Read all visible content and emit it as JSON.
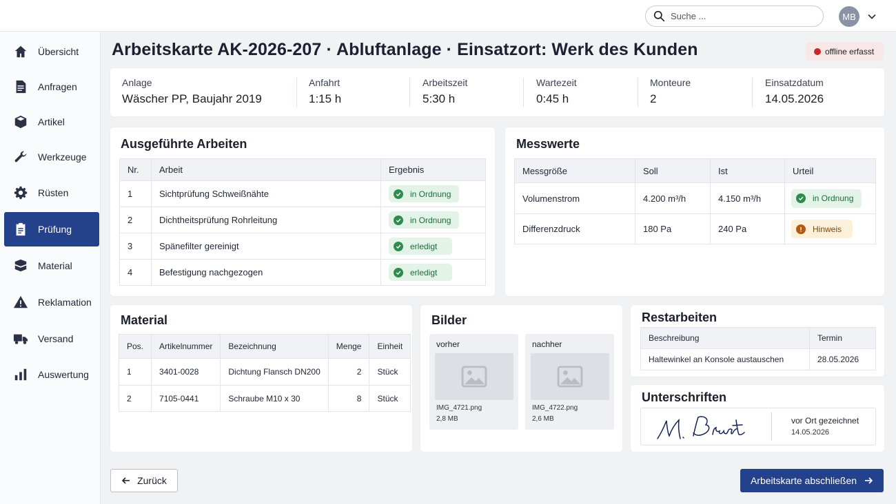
{
  "header": {
    "search_placeholder": "Suche ...",
    "avatar_initials": "MB"
  },
  "sidebar": {
    "items": [
      {
        "label": "Übersicht",
        "icon": "home-icon"
      },
      {
        "label": "Anfragen",
        "icon": "document-icon"
      },
      {
        "label": "Artikel",
        "icon": "box-icon"
      },
      {
        "label": "Werkzeuge",
        "icon": "wrench-icon"
      },
      {
        "label": "Rüsten",
        "icon": "gear-icon"
      },
      {
        "label": "Prüfung",
        "icon": "clipboard-icon",
        "active": true
      },
      {
        "label": "Material",
        "icon": "boxes-icon"
      },
      {
        "label": "Reklamation",
        "icon": "warning-icon"
      },
      {
        "label": "Versand",
        "icon": "truck-icon"
      },
      {
        "label": "Auswertung",
        "icon": "bar-chart-icon"
      }
    ]
  },
  "page": {
    "title": "Arbeitskarte AK-2026-207 · Abluftanlage · Einsatzort: Werk des Kunden",
    "status_badge": "offline erfasst",
    "status_color": "#c82727"
  },
  "info": [
    {
      "key": "Anlage",
      "value": "Wäscher PP, Baujahr 2019"
    },
    {
      "key": "Anfahrt",
      "value": "1:15 h"
    },
    {
      "key": "Arbeitszeit",
      "value": "5:30 h"
    },
    {
      "key": "Wartezeit",
      "value": "0:45 h"
    },
    {
      "key": "Monteure",
      "value": "2"
    },
    {
      "key": "Einsatzdatum",
      "value": "14.05.2026"
    }
  ],
  "arbeiten": {
    "title": "Ausgeführte Arbeiten",
    "headers": [
      "Nr.",
      "Arbeit",
      "Ergebnis"
    ],
    "rows": [
      {
        "nr": "1",
        "arbeit": "Sichtprüfung Schweißnähte",
        "ergebnis": "in Ordnung"
      },
      {
        "nr": "2",
        "arbeit": "Dichtheitsprüfung Rohrleitung",
        "ergebnis": "in Ordnung"
      },
      {
        "nr": "3",
        "arbeit": "Spänefilter gereinigt",
        "ergebnis": "erledigt"
      },
      {
        "nr": "4",
        "arbeit": "Befestigung nachgezogen",
        "ergebnis": "erledigt"
      }
    ]
  },
  "messwerte": {
    "title": "Messwerte",
    "headers": [
      "Messgröße",
      "Soll",
      "Ist",
      "Urteil"
    ],
    "rows": [
      {
        "groesse": "Volumenstrom",
        "soll": "4.200 m³/h",
        "ist": "4.150 m³/h",
        "urteil": "in Ordnung",
        "status": "ok"
      },
      {
        "groesse": "Differenzdruck",
        "soll": "180 Pa",
        "ist": "240 Pa",
        "urteil": "Hinweis",
        "status": "warn"
      }
    ]
  },
  "material": {
    "title": "Material",
    "headers": [
      "Pos.",
      "Artikelnummer",
      "Bezeichnung",
      "Menge",
      "Einheit"
    ],
    "rows": [
      {
        "pos": "1",
        "artikel": "3401-0028",
        "bezeichnung": "Dichtung Flansch DN200",
        "menge": "2",
        "einheit": "Stück"
      },
      {
        "pos": "2",
        "artikel": "7105-0441",
        "bezeichnung": "Schraube M10 x 30",
        "menge": "8",
        "einheit": "Stück"
      }
    ]
  },
  "bilder": {
    "title": "Bilder",
    "items": [
      {
        "caption": "vorher",
        "filename": "IMG_4721.png",
        "size": "2,8 MB"
      },
      {
        "caption": "nachher",
        "filename": "IMG_4722.png",
        "size": "2,6 MB"
      }
    ]
  },
  "restarbeiten": {
    "title": "Restarbeiten",
    "headers": [
      "Beschreibung",
      "Termin"
    ],
    "rows": [
      {
        "beschreibung": "Haltewinkel an Konsole austauschen",
        "termin": "28.05.2026"
      }
    ]
  },
  "unterschriften": {
    "title": "Unterschriften",
    "signature_name": "M. Brandt",
    "label": "vor Ort gezeichnet",
    "date": "14.05.2026"
  },
  "actions": {
    "back": "Zurück",
    "finish": "Arbeitskarte abschließen"
  },
  "colors": {
    "primary": "#24418c",
    "ok": "#2f8b4e",
    "warn": "#b35a10"
  }
}
